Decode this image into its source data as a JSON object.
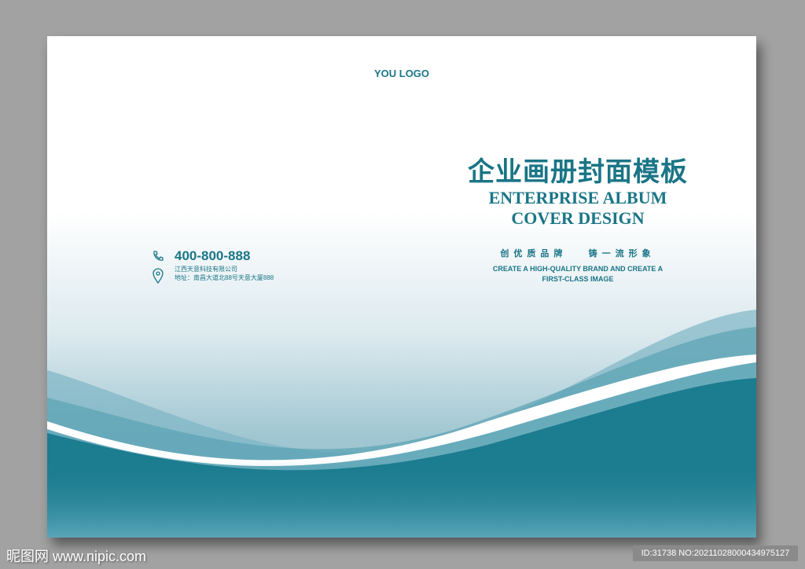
{
  "cover": {
    "logo": "YOU LOGO",
    "title_cn": "企业画册封面模板",
    "title_en_1": "ENTERPRISE ALBUM",
    "title_en_2": "COVER DESIGN",
    "slogan_cn_1": "创优质品牌",
    "slogan_cn_2": "铸一流形象",
    "slogan_en": "CREATE A HIGH-QUALITY BRAND AND CREATE A FIRST-CLASS IMAGE",
    "phone": "400-800-888",
    "company": "江西天意科技有限公司",
    "address": "地址：南昌大道北88号天意大厦888"
  },
  "watermark": {
    "site": "昵图网 www.nipic.com",
    "id": "ID:31738 NO:20211028000434975127"
  },
  "colors": {
    "accent": "#1a7586"
  }
}
